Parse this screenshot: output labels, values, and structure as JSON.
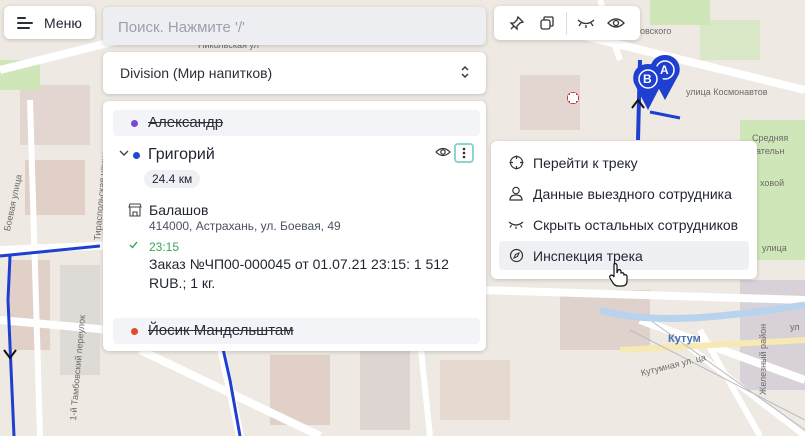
{
  "menu": {
    "label": "Меню"
  },
  "search": {
    "placeholder": "Поиск. Нажмите '/'"
  },
  "division": {
    "label": "Division (Мир напитков)"
  },
  "employees": [
    {
      "name": "Александр",
      "color": "#7b45d9",
      "hidden": true
    },
    {
      "name": "Григорий",
      "color": "#1f48d6",
      "hidden": false,
      "expanded": true,
      "distance": "24.4 км",
      "stop": {
        "name": "Балашов",
        "address": "414000, Астрахань, ул. Боевая, 49"
      },
      "event": {
        "time": "23:15",
        "text": "Заказ №ЧП00-000045 от 01.07.21 23:15: 1 512 RUB.; 1 кг."
      }
    },
    {
      "name": "Йосик Мандельштам",
      "color": "#e04a25",
      "hidden": true
    }
  ],
  "context_menu": {
    "items": [
      {
        "label": "Перейти к треку",
        "icon": "crosshair-icon"
      },
      {
        "label": "Данные выездного сотрудника",
        "icon": "user-icon"
      },
      {
        "label": "Скрыть остальных сотрудников",
        "icon": "eye-closed-icon"
      },
      {
        "label": "Инспекция трека",
        "icon": "compass-icon"
      }
    ],
    "hovered_index": 3
  },
  "map": {
    "labels": {
      "street_kosmonavtov": "улица Космонавтов",
      "street_boevaya": "Боевая улица",
      "kutum": "Кутум",
      "kutumnaya": "Кутумная ул. ца",
      "tambov": "1-й Тамбовский переулок",
      "tiraspol": "Тираспольская улица",
      "ovskogo": "овского",
      "nikol": "Никольская ул",
      "sredn": "Средняя",
      "vatel": "ательн",
      "hovaya": "ховой",
      "ulitsa": "улица",
      "zheleznyi": "Железный район",
      "ul_right": "ул"
    },
    "markers": [
      {
        "letter": "A"
      },
      {
        "letter": "B"
      }
    ],
    "track_color": "#1f3fd1"
  }
}
